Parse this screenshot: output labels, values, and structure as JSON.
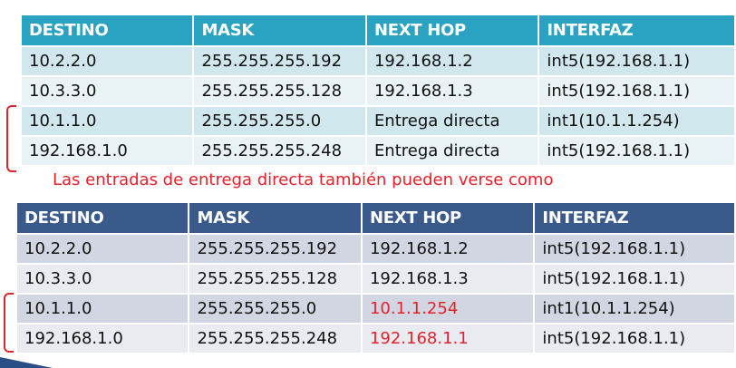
{
  "table1": {
    "headers": [
      "DESTINO",
      "MASK",
      "NEXT HOP",
      "INTERFAZ"
    ],
    "rows": [
      [
        "10.2.2.0",
        "255.255.255.192",
        "192.168.1.2",
        "int5(192.168.1.1)"
      ],
      [
        "10.3.3.0",
        "255.255.255.128",
        "192.168.1.3",
        "int5(192.168.1.1)"
      ],
      [
        "10.1.1.0",
        "255.255.255.0",
        "Entrega directa",
        "int1(10.1.1.254)"
      ],
      [
        "192.168.1.0",
        "255.255.255.248",
        "Entrega directa",
        "int5(192.168.1.1)"
      ]
    ]
  },
  "note": "Las entradas de entrega directa también pueden verse como",
  "table2": {
    "headers": [
      "DESTINO",
      "MASK",
      "NEXT HOP",
      "INTERFAZ"
    ],
    "rows": [
      [
        "10.2.2.0",
        "255.255.255.192",
        "192.168.1.2",
        "int5(192.168.1.1)"
      ],
      [
        "10.3.3.0",
        "255.255.255.128",
        "192.168.1.3",
        "int5(192.168.1.1)"
      ],
      [
        "10.1.1.0",
        "255.255.255.0",
        "10.1.1.254",
        "int1(10.1.1.254)"
      ],
      [
        "192.168.1.0",
        "255.255.255.248",
        "192.168.1.1",
        "int5(192.168.1.1)"
      ]
    ]
  },
  "colors": {
    "table1_header": "#2aa3c3",
    "table2_header": "#3a5a8c",
    "highlight_red": "#e8202a"
  }
}
